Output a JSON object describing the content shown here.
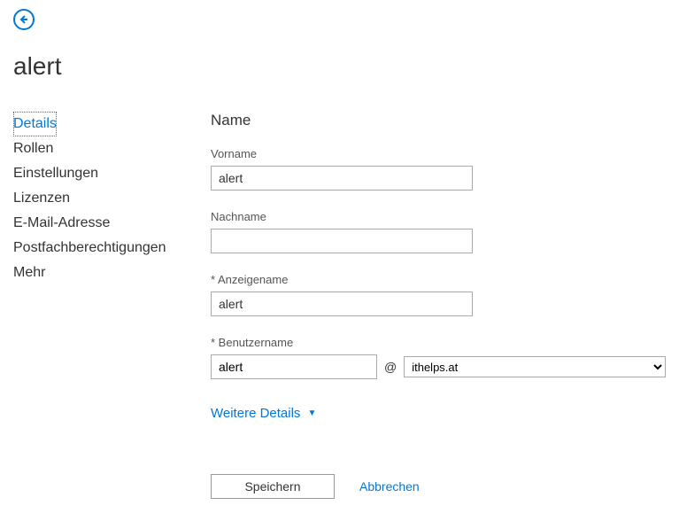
{
  "page_title": "alert",
  "sidebar": {
    "items": [
      {
        "label": "Details"
      },
      {
        "label": "Rollen"
      },
      {
        "label": "Einstellungen"
      },
      {
        "label": "Lizenzen"
      },
      {
        "label": "E-Mail-Adresse"
      },
      {
        "label": "Postfachberechtigungen"
      },
      {
        "label": "Mehr"
      }
    ]
  },
  "main": {
    "section_header": "Name",
    "vorname_label": "Vorname",
    "vorname_value": "alert",
    "nachname_label": "Nachname",
    "nachname_value": "",
    "anzeigename_label": "* Anzeigename",
    "anzeigename_value": "alert",
    "benutzername_label": "* Benutzername",
    "benutzername_value": "alert",
    "at_sign": "@",
    "domain_value": "ithelps.at",
    "more_details_label": "Weitere Details"
  },
  "footer": {
    "save_label": "Speichern",
    "cancel_label": "Abbrechen"
  }
}
